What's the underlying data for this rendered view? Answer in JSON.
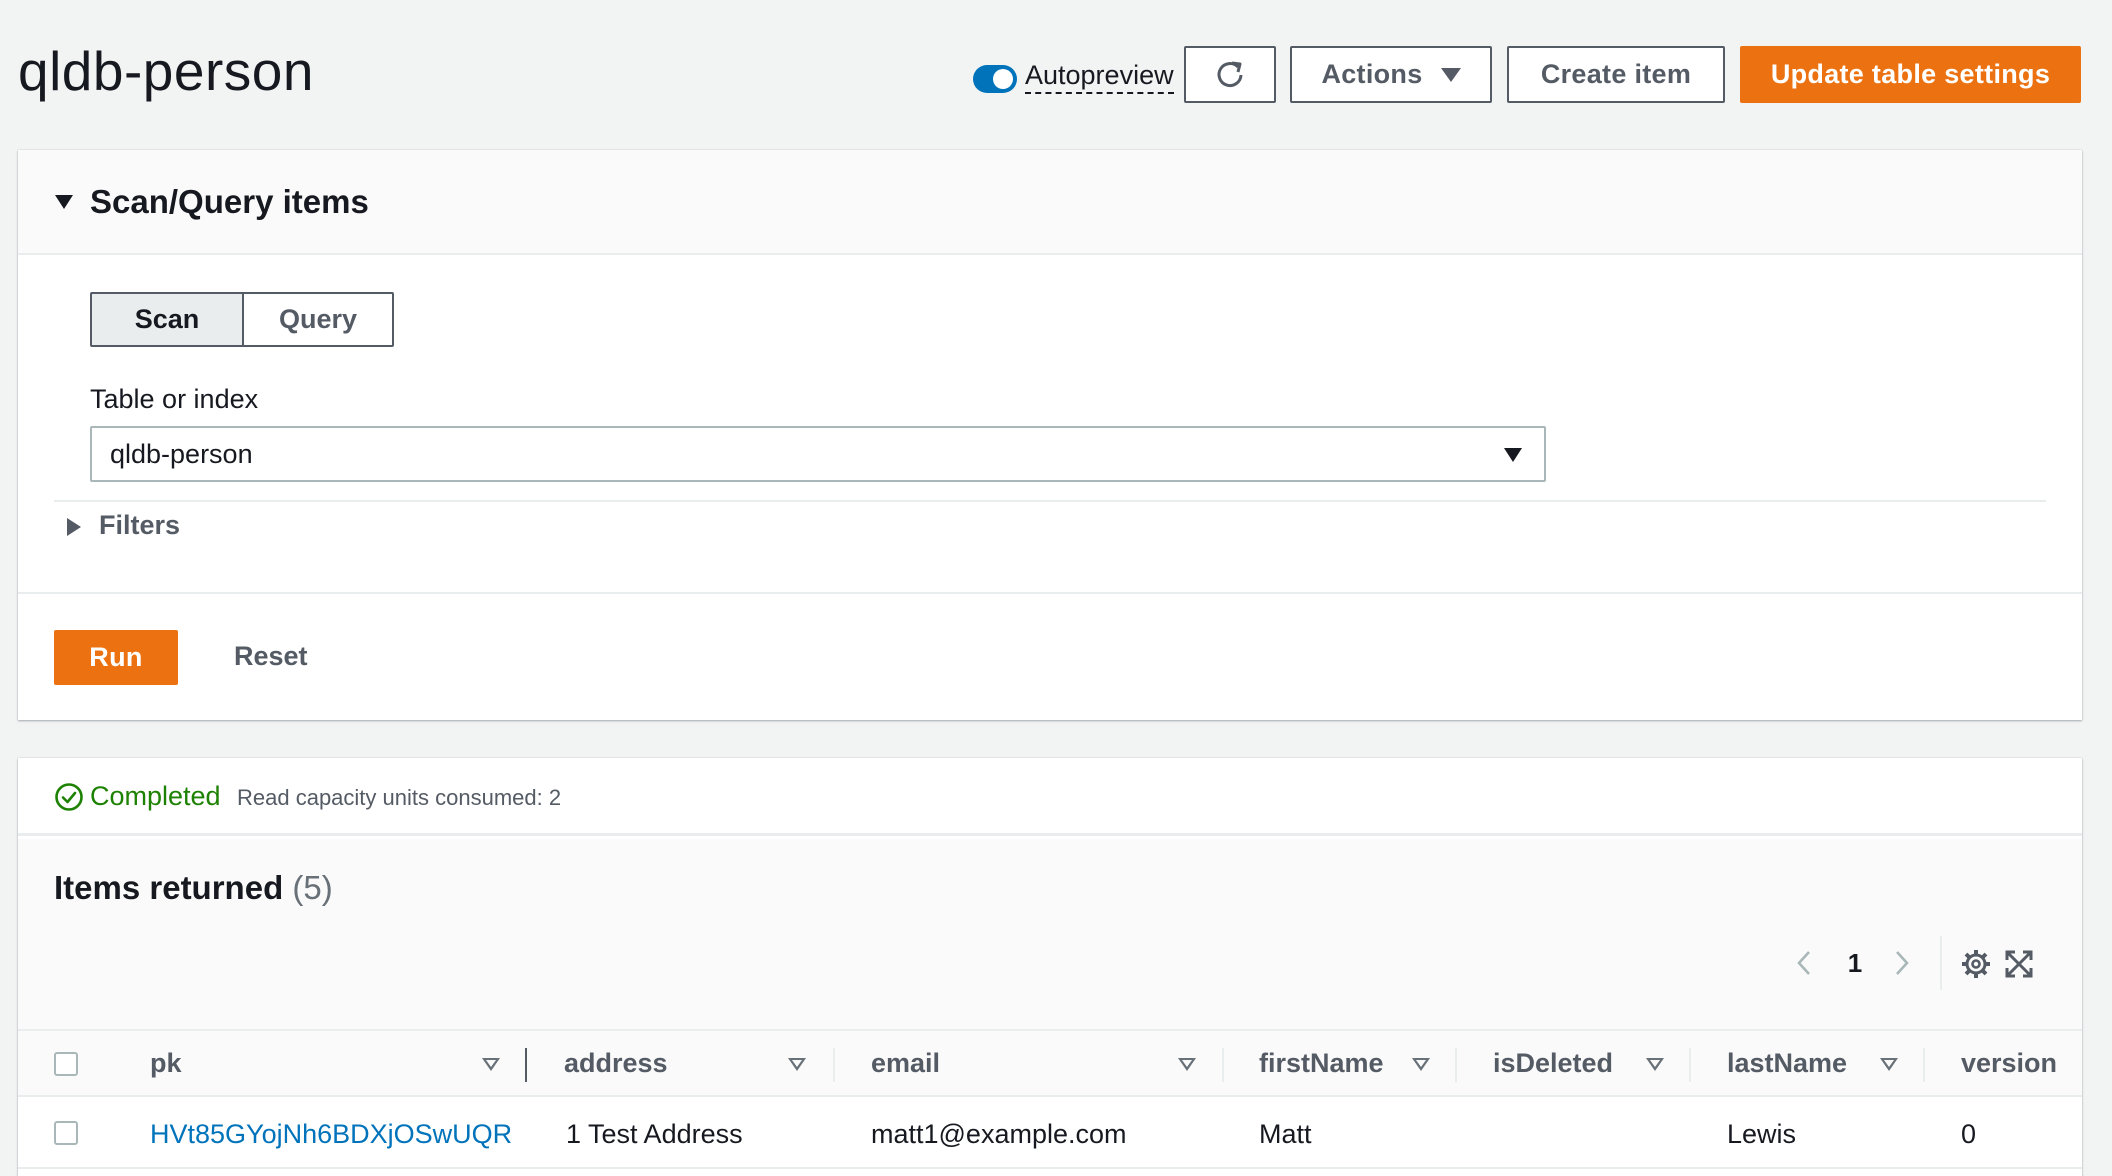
{
  "header": {
    "title": "qldb-person",
    "autopreview_label": "Autopreview",
    "actions_label": "Actions",
    "create_label": "Create item",
    "update_label": "Update table settings"
  },
  "scan_panel": {
    "title": "Scan/Query items",
    "segments": [
      "Scan",
      "Query"
    ],
    "selected_segment": "Scan",
    "table_label": "Table or index",
    "table_value": "qldb-person",
    "filters_label": "Filters",
    "run_label": "Run",
    "reset_label": "Reset"
  },
  "results": {
    "status": "Completed",
    "rcu_text": "Read capacity units consumed: 2",
    "items_title": "Items returned",
    "items_count": "(5)",
    "page": "1",
    "columns": [
      "pk",
      "address",
      "email",
      "firstName",
      "isDeleted",
      "lastName",
      "version"
    ],
    "rows": [
      {
        "pk": "HVt85GYojNh6BDXjOSwUQR",
        "address": "1 Test Address",
        "email": "matt1@example.com",
        "firstName": "Matt",
        "isDeleted": "",
        "lastName": "Lewis",
        "version": "0"
      }
    ]
  },
  "colors": {
    "accent_orange": "#ec7211",
    "toggle_blue": "#0073bb",
    "link_blue": "#0073bb",
    "success_green": "#1d8102"
  },
  "icons": [
    "refresh-icon",
    "caret-down-icon",
    "check-circle-icon",
    "chevron-left-icon",
    "chevron-right-icon",
    "gear-icon",
    "expand-icon"
  ]
}
